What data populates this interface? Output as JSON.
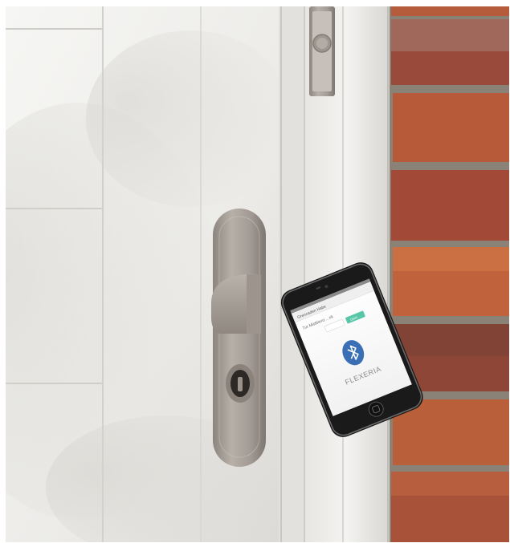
{
  "phone_screen": {
    "header_title": "Grenzaden Habe",
    "door_row": "Tur Mistblenz .. ok",
    "button_left": "",
    "button_right": "Open",
    "brand_text": "FLEXERIA"
  },
  "colors": {
    "door_white": "#f3f3f1",
    "brick_red": "#b0543a",
    "handle_metal": "#a9a19a",
    "screen_accent": "#57c7a8",
    "bluetooth_blue": "#3a6fb5"
  }
}
